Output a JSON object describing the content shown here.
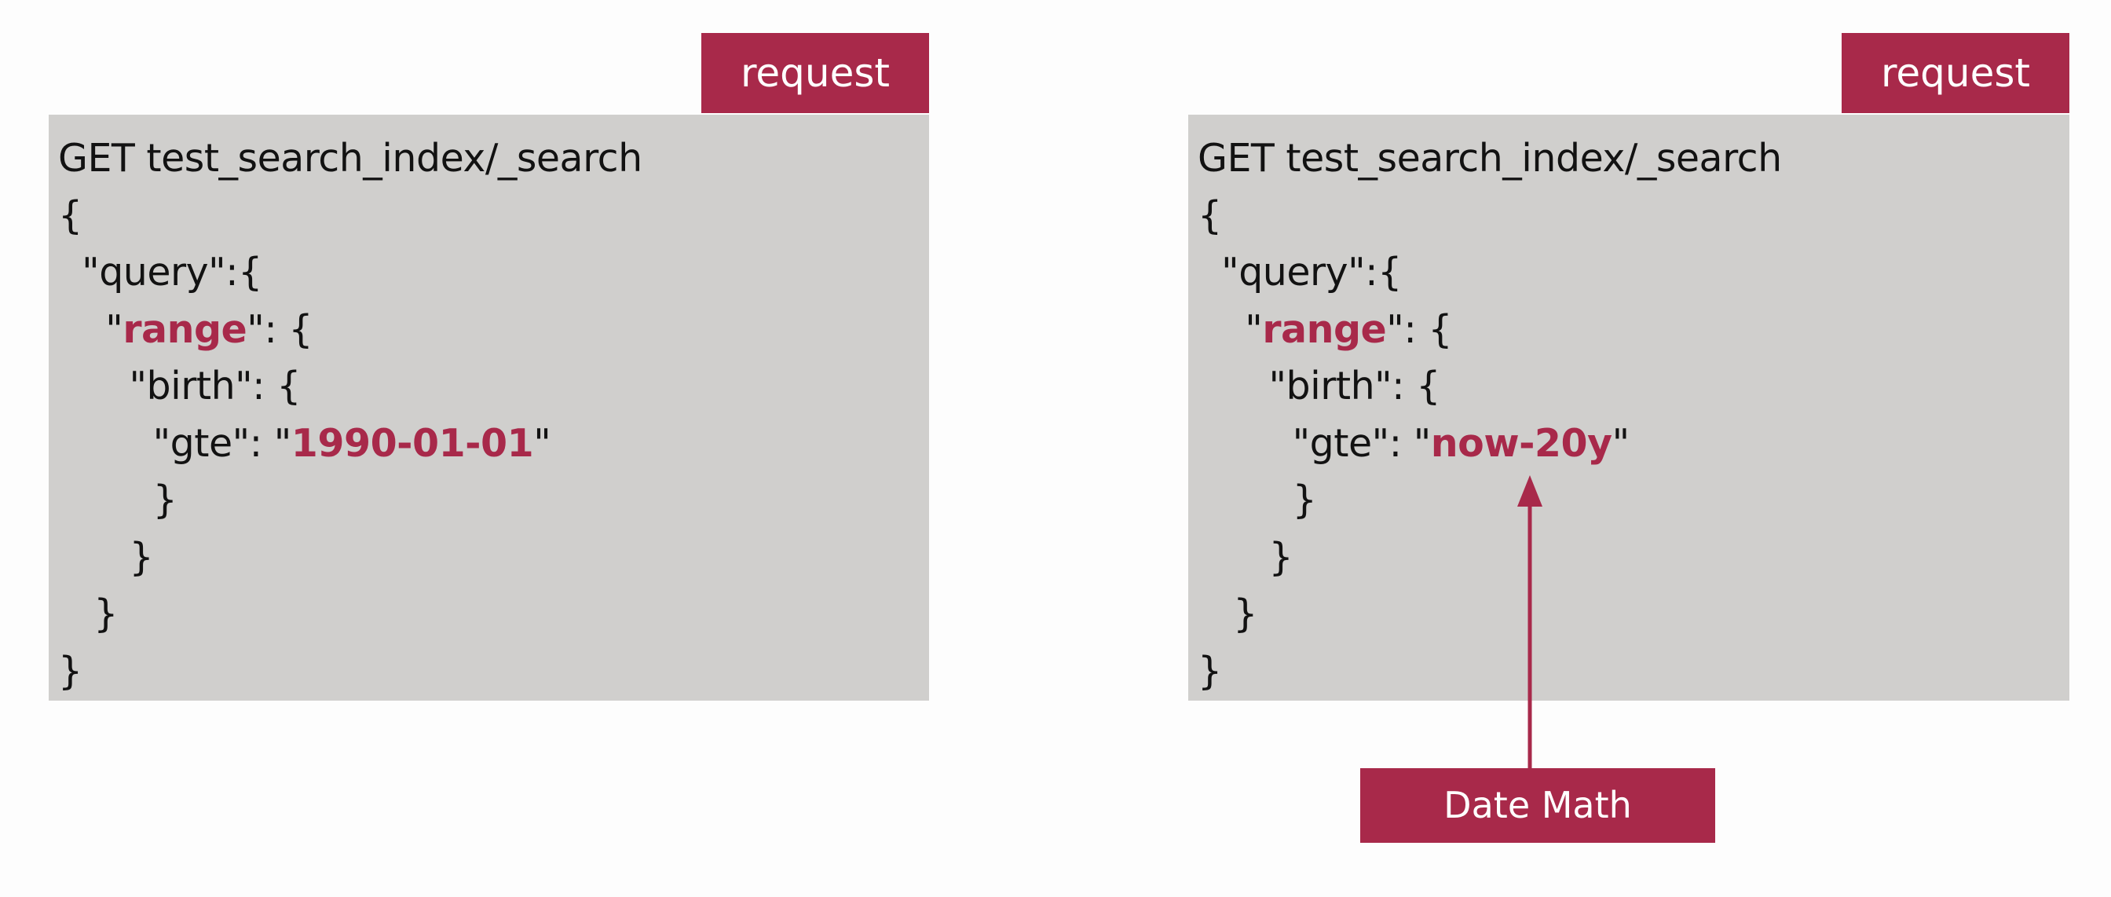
{
  "colors": {
    "accent": "#a8294a",
    "code_bg": "#d0cfcd",
    "text": "#121212"
  },
  "panels": [
    {
      "tag": "request",
      "lines": [
        {
          "pre": "GET test_search_index/_search",
          "hl": "",
          "post": ""
        },
        {
          "pre": "{",
          "hl": "",
          "post": ""
        },
        {
          "pre": "  \"query\":{",
          "hl": "",
          "post": ""
        },
        {
          "pre": "    \"",
          "hl": "range",
          "post": "\": {"
        },
        {
          "pre": "      \"birth\": {",
          "hl": "",
          "post": ""
        },
        {
          "pre": "        \"gte\": \"",
          "hl": "1990-01-01",
          "post": "\""
        },
        {
          "pre": "        }",
          "hl": "",
          "post": ""
        },
        {
          "pre": "      }",
          "hl": "",
          "post": ""
        },
        {
          "pre": "   }",
          "hl": "",
          "post": ""
        },
        {
          "pre": "}",
          "hl": "",
          "post": ""
        }
      ]
    },
    {
      "tag": "request",
      "lines": [
        {
          "pre": "GET test_search_index/_search",
          "hl": "",
          "post": ""
        },
        {
          "pre": "{",
          "hl": "",
          "post": ""
        },
        {
          "pre": "  \"query\":{",
          "hl": "",
          "post": ""
        },
        {
          "pre": "    \"",
          "hl": "range",
          "post": "\": {"
        },
        {
          "pre": "      \"birth\": {",
          "hl": "",
          "post": ""
        },
        {
          "pre": "        \"gte\": \"",
          "hl": "now-20y",
          "post": "\""
        },
        {
          "pre": "        }",
          "hl": "",
          "post": ""
        },
        {
          "pre": "      }",
          "hl": "",
          "post": ""
        },
        {
          "pre": "   }",
          "hl": "",
          "post": ""
        },
        {
          "pre": "}",
          "hl": "",
          "post": ""
        }
      ]
    }
  ],
  "annotation": {
    "label": "Date Math"
  }
}
